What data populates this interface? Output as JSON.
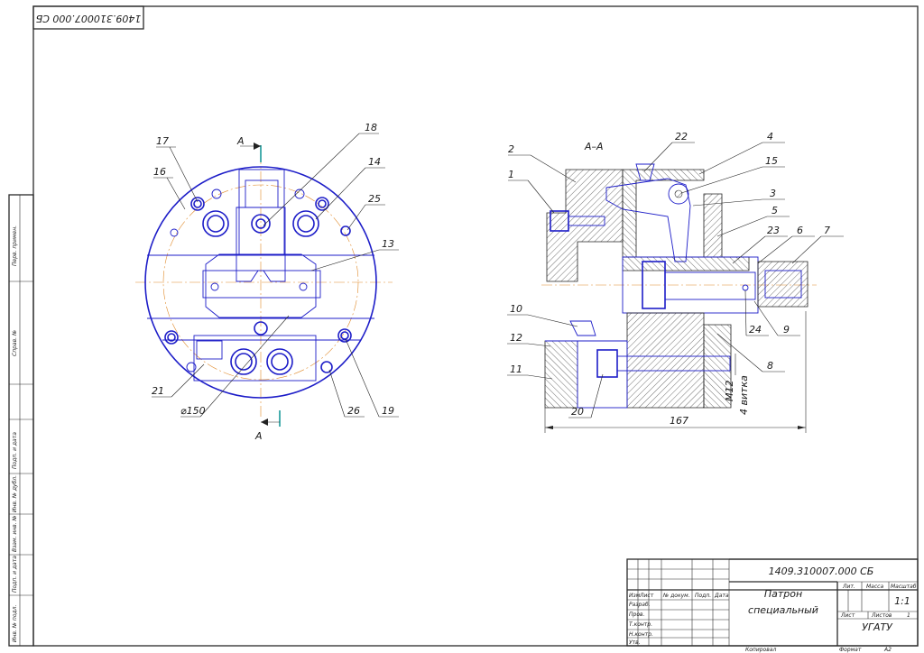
{
  "drawing": {
    "code_top": "1409.310007.000 СБ",
    "view_a_label": "А",
    "view_a_label_bottom": "А",
    "section_title": "А–А",
    "diameter_label": "⌀150",
    "dim_length": "167",
    "dim_thread": "M12",
    "dim_thread_note": "4 витка",
    "left_view_callouts": [
      "17",
      "16",
      "18",
      "14",
      "25",
      "13",
      "21",
      "26",
      "19"
    ],
    "section_callouts": [
      "22",
      "4",
      "2",
      "15",
      "1",
      "3",
      "5",
      "23",
      "6",
      "7",
      "24",
      "9",
      "10",
      "12",
      "8",
      "11",
      "20"
    ]
  },
  "side_strip": [
    "Перв. примен.",
    "Справ. №",
    "Подп. и дата",
    "Инв. № дубл.",
    "Взам. инв. №",
    "Подп. и дата",
    "Инв. № подл."
  ],
  "title_block": {
    "designation": "1409.310007.000 СБ",
    "name_line1": "Патрон",
    "name_line2": "специальный",
    "hdr_izm": "Изм",
    "hdr_list": "Лист",
    "hdr_doc": "№ докум.",
    "hdr_sign": "Подп.",
    "hdr_date": "Дата",
    "row_razrab": "Разраб.",
    "row_prov": "Пров.",
    "row_tkontr": "Т.контр.",
    "row_nkontr": "Н.контр.",
    "row_utv": "Утв.",
    "lit": "Лит.",
    "mass": "Масса",
    "scale": "Масштаб",
    "scale_value": "1:1",
    "sheet": "Лист",
    "sheets": "Листов",
    "sheets_value": "1",
    "org": "УГАТУ",
    "copied": "Копировал",
    "format": "Формат",
    "format_value": "А2"
  }
}
